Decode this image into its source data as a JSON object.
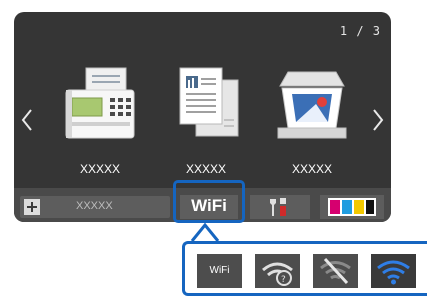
{
  "screen": {
    "page_indicator": "1 / 3",
    "apps": [
      {
        "label": "XXXXX",
        "icon": "fax-machine-icon"
      },
      {
        "label": "XXXXX",
        "icon": "copy-documents-icon"
      },
      {
        "label": "XXXXX",
        "icon": "scanner-icon"
      }
    ]
  },
  "bottom_bar": {
    "shortcut_label": "XXXXX",
    "wifi_label": "WiFi",
    "tools_icon": "tools-icon",
    "ink_icon": "ink-cartridges-icon"
  },
  "status_panel": {
    "wifi_text": "WiFi",
    "icons": [
      "wifi-text-icon",
      "wifi-unknown-icon",
      "wifi-off-icon",
      "wifi-connected-icon"
    ]
  },
  "colors": {
    "screen": "#353535",
    "bar": "#4a4a4a",
    "highlight": "#1565c0",
    "wifi_connected": "#2f7ee6",
    "ink_black": "#111111",
    "ink_yellow": "#f2c800",
    "ink_magenta": "#d6006f",
    "ink_cyan": "#1f9de0"
  }
}
